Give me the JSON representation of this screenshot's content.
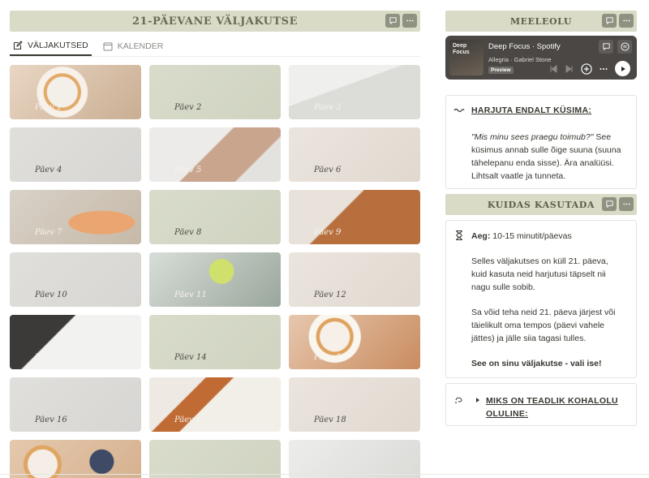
{
  "main": {
    "title": "21-PÄEVANE VÄLJAKUTSE",
    "tabs": [
      {
        "label": "VÄLJAKUTSED",
        "icon": "edit-icon",
        "active": true
      },
      {
        "label": "KALENDER",
        "icon": "calendar-icon",
        "active": false
      }
    ],
    "days": [
      "Päev 1",
      "Päev 2",
      "Päev 3",
      "Päev 4",
      "Päev 5",
      "Päev 6",
      "Päev 7",
      "Päev 8",
      "Päev 9",
      "Päev 10",
      "Päev 11",
      "Päev 12",
      "Päev 13",
      "Päev 14",
      "Päev 15",
      "Päev 16",
      "Päev 17",
      "Päev 18",
      "",
      "",
      ""
    ]
  },
  "sidebar": {
    "mood_title": "MEELEOLU",
    "spotify": {
      "cover_text": "Deep Focus",
      "title": "Deep Focus · Spotify",
      "artist": "Allegria · Gabriel Stone",
      "badge": "Preview"
    },
    "practice": {
      "heading": "HARJUTA ENDALT KÜSIMA:",
      "question": "\"Mis minu sees praegu toimub?\"",
      "text": " See küsimus annab sulle õige suuna (suuna tähelepanu enda sisse). Ära analüüsi. Lihtsalt vaatle ja tunneta."
    },
    "howto_title": "KUIDAS KASUTADA",
    "howto": {
      "time_label": "Aeg:",
      "time_value": " 10-15 minutit/päevas",
      "p1": "Selles väljakutses on küll 21. päeva, kuid kasuta neid harjutusi täpselt nii nagu sulle sobib.",
      "p2": "Sa võid teha neid 21. päeva järjest või täielikult oma tempos (päevi vahele jättes) ja jälle siia tagasi tulles.",
      "p3": "See on sinu väljakutse - vali ise!"
    },
    "why_heading": "MIKS ON TEADLIK KOHALOLU OLULINE:"
  }
}
